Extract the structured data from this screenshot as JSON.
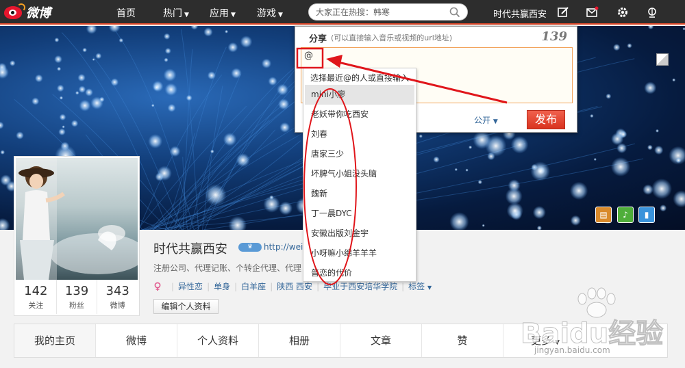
{
  "brand": {
    "logo_text": "微博"
  },
  "nav": {
    "home": "首页",
    "hot": "热门",
    "apps": "应用",
    "games": "游戏",
    "search_placeholder": "大家正在热搜：韩寒",
    "username": "时代共赢西安"
  },
  "share": {
    "title": "分享",
    "hint": "(可以直接输入音乐或视频的url地址)",
    "count": "139",
    "text": "@",
    "visibility": "公开",
    "publish": "发布"
  },
  "mention": {
    "hint": "选择最近@的人或直接输入",
    "items": [
      "mini小廖",
      "老妖带你吃西安",
      "刘春",
      "唐家三少",
      "坏脾气小姐没头脑",
      "魏新",
      "丁一晨DYC",
      "安徽出版刘金宇",
      "小呀嘛小绵羊羊羊",
      "普恋的代价"
    ]
  },
  "profile": {
    "name": "时代共赢西安",
    "url": "http://weib",
    "desc": "注册公司、代理记账、个转企代理、代理",
    "tags": [
      "异性恋",
      "单身",
      "白羊座",
      "陕西 西安",
      "毕业于西安培华学院",
      "标签"
    ],
    "edit": "编辑个人资料",
    "stats": [
      {
        "num": "142",
        "label": "关注"
      },
      {
        "num": "139",
        "label": "粉丝"
      },
      {
        "num": "343",
        "label": "微博"
      }
    ]
  },
  "tabs": [
    "我的主页",
    "微博",
    "个人资料",
    "相册",
    "文章",
    "赞",
    "更多"
  ],
  "watermark": {
    "text": "Baidu经验",
    "url": "jingyan.baidu.com"
  },
  "colors": {
    "accent": "#e14a2b",
    "link": "#336699",
    "publish": "#d9331f"
  }
}
